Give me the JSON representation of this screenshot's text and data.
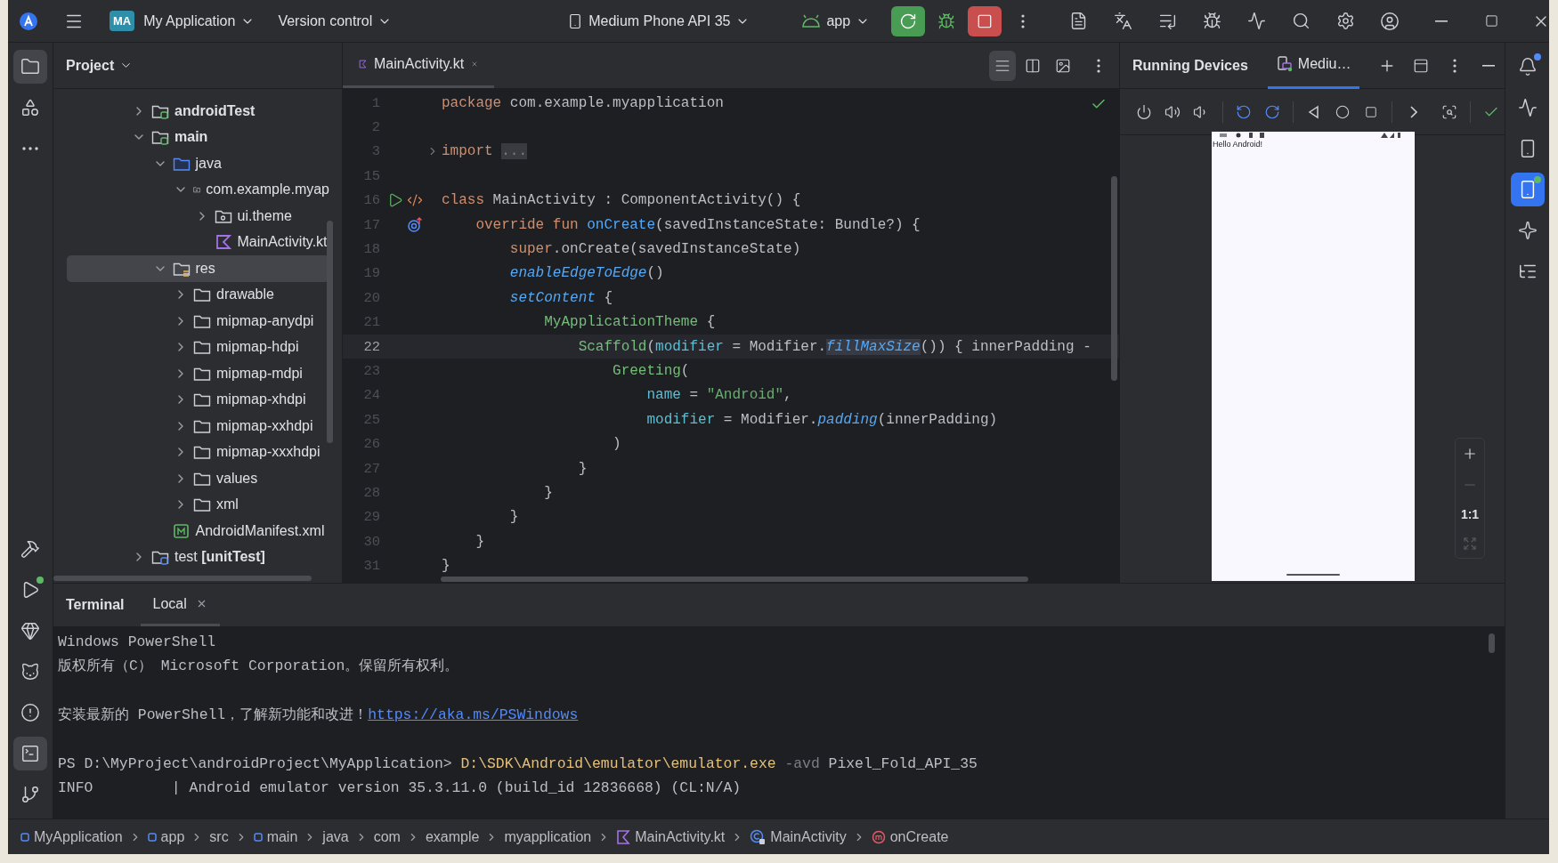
{
  "title_bar": {
    "project_badge": "MA",
    "project": "My Application",
    "vcs": "Version control",
    "device": "Medium Phone API 35",
    "run_config": "app"
  },
  "left_strip": {
    "top": [
      {
        "kind": "project",
        "selected": true
      },
      {
        "kind": "resources",
        "selected": false
      },
      {
        "kind": "more",
        "selected": false
      }
    ],
    "bottom": [
      {
        "kind": "build",
        "selected": false
      },
      {
        "kind": "run",
        "selected": false
      },
      {
        "kind": "gem",
        "selected": false
      },
      {
        "kind": "logcat",
        "selected": false
      },
      {
        "kind": "problems",
        "selected": false
      },
      {
        "kind": "terminal",
        "selected": true
      },
      {
        "kind": "git",
        "selected": false
      }
    ]
  },
  "project_panel": {
    "title": "Project",
    "tree": [
      {
        "label": "androidTest",
        "kind": "module",
        "expanded": false,
        "selected": false
      },
      {
        "label": "main",
        "kind": "module",
        "expanded": true,
        "selected": false,
        "children": [
          {
            "label": "java",
            "kind": "source",
            "expanded": true,
            "selected": false,
            "children": [
              {
                "label": "com.example.myap",
                "kind": "package",
                "expanded": true,
                "selected": false,
                "children": [
                  {
                    "label": "ui.theme",
                    "kind": "package",
                    "expanded": false,
                    "selected": false
                  },
                  {
                    "label": "MainActivity.kt",
                    "kind": "kotlin",
                    "selected": false
                  }
                ]
              }
            ]
          },
          {
            "label": "res",
            "kind": "resources",
            "expanded": true,
            "selected": true,
            "children": [
              {
                "label": "drawable",
                "kind": "folder",
                "expanded": false,
                "selected": false
              },
              {
                "label": "mipmap-anydpi",
                "kind": "folder",
                "expanded": false,
                "selected": false
              },
              {
                "label": "mipmap-hdpi",
                "kind": "folder",
                "expanded": false,
                "selected": false
              },
              {
                "label": "mipmap-mdpi",
                "kind": "folder",
                "expanded": false,
                "selected": false
              },
              {
                "label": "mipmap-xhdpi",
                "kind": "folder",
                "expanded": false,
                "selected": false
              },
              {
                "label": "mipmap-xxhdpi",
                "kind": "folder",
                "expanded": false,
                "selected": false
              },
              {
                "label": "mipmap-xxxhdpi",
                "kind": "folder",
                "expanded": false,
                "selected": false
              },
              {
                "label": "values",
                "kind": "folder",
                "expanded": false,
                "selected": false
              },
              {
                "label": "xml",
                "kind": "folder",
                "expanded": false,
                "selected": false
              }
            ]
          },
          {
            "label": "AndroidManifest.xml",
            "kind": "manifest",
            "selected": false
          }
        ]
      },
      {
        "label": "test **[unitTest]**",
        "kind": "test-module",
        "expanded": false,
        "selected": false
      }
    ]
  },
  "editor": {
    "tabs": [
      {
        "label": "MainActivity.kt",
        "selected": true
      }
    ],
    "view_modes": [
      {
        "kind": "code",
        "selected": true
      },
      {
        "kind": "split",
        "selected": false
      },
      {
        "kind": "design",
        "selected": false
      }
    ],
    "lines": [
      {
        "number": "1",
        "current": false,
        "tokens": [
          {
            "text": "package",
            "kind": "kw"
          },
          {
            "text": " com.example.myapplication",
            "kind": "plain"
          }
        ]
      },
      {
        "number": "2",
        "current": false
      },
      {
        "number": "3",
        "current": false,
        "gutter": {
          "kind": "fold"
        },
        "tokens": [
          {
            "text": "import ",
            "kind": "kw"
          },
          {
            "text": "...",
            "kind": "folded"
          }
        ]
      },
      {
        "number": "15",
        "current": false
      },
      {
        "number": "16",
        "current": false,
        "gutter": {
          "kind": "run"
        },
        "tokens": [
          {
            "text": "class",
            "kind": "kw"
          },
          {
            "text": " MainActivity : ComponentActivity() {",
            "kind": "plain"
          }
        ]
      },
      {
        "number": "17",
        "current": false,
        "gutter": {
          "kind": "override"
        },
        "tokens": [
          {
            "text": "    override fun",
            "kind": "kw"
          },
          {
            "text": " onCreate",
            "kind": "decl"
          },
          {
            "text": "(savedInstanceState: Bundle?) {",
            "kind": "plain"
          }
        ]
      },
      {
        "number": "18",
        "current": false,
        "tokens": [
          {
            "text": "        super",
            "kind": "kw"
          },
          {
            "text": ".onCreate(savedInstanceState)",
            "kind": "plain"
          }
        ]
      },
      {
        "number": "19",
        "current": false,
        "tokens": [
          {
            "text": "        enableEdgeToEdge",
            "kind": "call"
          },
          {
            "text": "()",
            "kind": "plain"
          }
        ]
      },
      {
        "number": "20",
        "current": false,
        "tokens": [
          {
            "text": "        setContent",
            "kind": "call"
          },
          {
            "text": " {",
            "kind": "plain"
          }
        ]
      },
      {
        "number": "21",
        "current": false,
        "tokens": [
          {
            "text": "            MyApplicationTheme",
            "kind": "compose"
          },
          {
            "text": " {",
            "kind": "plain"
          }
        ]
      },
      {
        "number": "22",
        "current": true,
        "tokens": [
          {
            "text": "                Scaffold",
            "kind": "compose"
          },
          {
            "text": "(",
            "kind": "plain"
          },
          {
            "text": "modifier",
            "kind": "named"
          },
          {
            "text": " = Modifier.",
            "kind": "plain"
          },
          {
            "text": "fillMaxSize",
            "kind": "call-hl"
          },
          {
            "text": "()) { innerPadding -",
            "kind": "plain"
          }
        ]
      },
      {
        "number": "23",
        "current": false,
        "tokens": [
          {
            "text": "                    Greeting",
            "kind": "compose"
          },
          {
            "text": "(",
            "kind": "plain"
          }
        ]
      },
      {
        "number": "24",
        "current": false,
        "tokens": [
          {
            "text": "                        name",
            "kind": "named"
          },
          {
            "text": " = ",
            "kind": "plain"
          },
          {
            "text": "\"Android\"",
            "kind": "string"
          },
          {
            "text": ",",
            "kind": "plain"
          }
        ]
      },
      {
        "number": "25",
        "current": false,
        "tokens": [
          {
            "text": "                        modifier",
            "kind": "named"
          },
          {
            "text": " = Modifier.",
            "kind": "plain"
          },
          {
            "text": "padding",
            "kind": "call"
          },
          {
            "text": "(innerPadding)",
            "kind": "plain"
          }
        ]
      },
      {
        "number": "26",
        "current": false,
        "tokens": [
          {
            "text": "                    )",
            "kind": "plain"
          }
        ]
      },
      {
        "number": "27",
        "current": false,
        "tokens": [
          {
            "text": "                }",
            "kind": "plain"
          }
        ]
      },
      {
        "number": "28",
        "current": false,
        "tokens": [
          {
            "text": "            }",
            "kind": "plain"
          }
        ]
      },
      {
        "number": "29",
        "current": false,
        "tokens": [
          {
            "text": "        }",
            "kind": "plain"
          }
        ]
      },
      {
        "number": "30",
        "current": false,
        "tokens": [
          {
            "text": "    }",
            "kind": "plain"
          }
        ]
      },
      {
        "number": "31",
        "current": false,
        "tokens": [
          {
            "text": "}",
            "kind": "plain"
          }
        ]
      }
    ]
  },
  "devices_panel": {
    "title": "Running Devices",
    "tabs": [
      {
        "label": "Mediu…",
        "selected": true
      }
    ],
    "screen_text": "Hello Android!",
    "zoom_label": "1:1"
  },
  "right_strip": [
    {
      "kind": "notifications",
      "selected": false
    },
    {
      "kind": "gradle",
      "selected": false
    },
    {
      "kind": "device-manager",
      "selected": false
    },
    {
      "kind": "running-devices",
      "selected": true
    },
    {
      "kind": "gemini",
      "selected": false
    },
    {
      "kind": "structure",
      "selected": false
    }
  ],
  "terminal": {
    "title": "Terminal",
    "tabs": [
      {
        "label": "Local",
        "selected": true
      }
    ],
    "lines": [
      {
        "kind": "text",
        "segments": [
          {
            "text": "Windows PowerShell",
            "kind": "plain"
          }
        ]
      },
      {
        "kind": "text",
        "segments": [
          {
            "text": "版权所有（C） Microsoft Corporation。保留所有权利。",
            "kind": "plain"
          }
        ]
      },
      {
        "kind": "blank"
      },
      {
        "kind": "text",
        "segments": [
          {
            "text": "安装最新的 PowerShell，了解新功能和改进！",
            "kind": "plain"
          },
          {
            "text": "https://aka.ms/PSWindows",
            "kind": "link"
          }
        ]
      },
      {
        "kind": "blank"
      },
      {
        "kind": "text",
        "segments": [
          {
            "text": "PS D:\\MyProject\\androidProject\\MyApplication> ",
            "kind": "plain"
          },
          {
            "text": "D:\\SDK\\Android\\emulator\\emulator.exe",
            "kind": "command"
          },
          {
            "text": " -avd",
            "kind": "option"
          },
          {
            "text": " Pixel_Fold_API_35",
            "kind": "plain"
          }
        ]
      },
      {
        "kind": "text",
        "segments": [
          {
            "text": "INFO         | Android emulator version 35.3.11.0 (build_id 12836668) (CL:N/A)",
            "kind": "plain"
          }
        ]
      }
    ]
  },
  "breadcrumb": [
    {
      "label": "MyApplication",
      "kind": "module"
    },
    {
      "label": "app",
      "kind": "module"
    },
    {
      "label": "src",
      "kind": "plain"
    },
    {
      "label": "main",
      "kind": "module"
    },
    {
      "label": "java",
      "kind": "plain"
    },
    {
      "label": "com",
      "kind": "plain"
    },
    {
      "label": "example",
      "kind": "plain"
    },
    {
      "label": "myapplication",
      "kind": "plain"
    },
    {
      "label": "MainActivity.kt",
      "kind": "kotlin"
    },
    {
      "label": "MainActivity",
      "kind": "class"
    },
    {
      "label": "onCreate",
      "kind": "method"
    }
  ]
}
